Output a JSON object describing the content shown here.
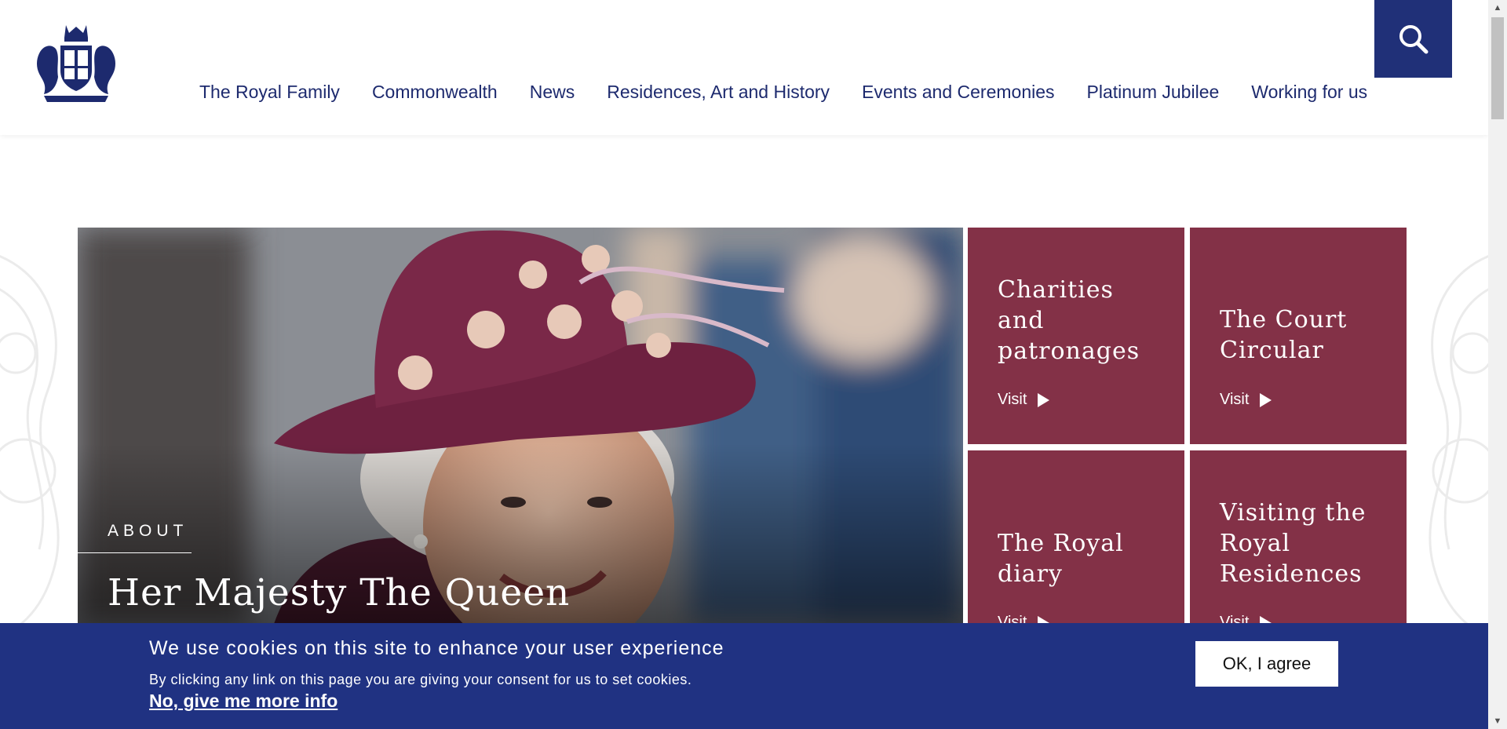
{
  "brand": {
    "logo_icon": "royal-coat-of-arms-icon",
    "accent": "#203078",
    "tile_color": "#833147",
    "cookie_bg": "#203282"
  },
  "header": {
    "search_icon": "search-icon"
  },
  "nav": {
    "items": [
      {
        "label": "The Royal Family"
      },
      {
        "label": "Commonwealth"
      },
      {
        "label": "News"
      },
      {
        "label": "Residences, Art and History"
      },
      {
        "label": "Events and Ceremonies"
      },
      {
        "label": "Platinum Jubilee"
      },
      {
        "label": "Working for us"
      }
    ]
  },
  "hero": {
    "kicker": "ABOUT",
    "title": "Her Majesty The Queen"
  },
  "tiles": [
    {
      "title": "Charities and patronages",
      "visit": "Visit"
    },
    {
      "title": "The Court Circular",
      "visit": "Visit"
    },
    {
      "title": "The Royal diary",
      "visit": "Visit"
    },
    {
      "title": "Visiting the Royal Residences",
      "visit": "Visit"
    }
  ],
  "cookie": {
    "heading": "We use cookies on this site to enhance your user experience",
    "text": "By clicking any link on this page you are giving your consent for us to set cookies.",
    "more_link": "No, give me more info",
    "agree": "OK, I agree"
  }
}
